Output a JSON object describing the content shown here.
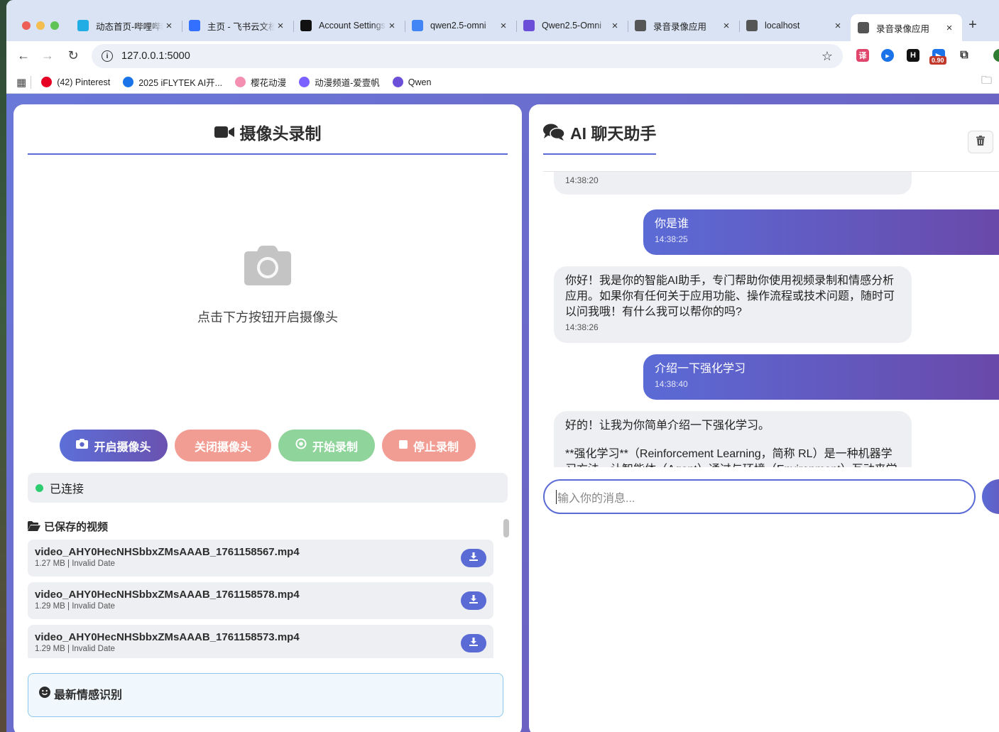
{
  "browser": {
    "tabs": [
      {
        "title": "动态首页-哔哩哔哩",
        "icon": "bilibili-icon",
        "color": "#23ade5"
      },
      {
        "title": "主页 - 飞书云文档",
        "icon": "feishu-icon",
        "color": "#3370ff"
      },
      {
        "title": "Account Settings",
        "icon": "terminal-icon",
        "color": "#111111"
      },
      {
        "title": "qwen2.5-omni",
        "icon": "google-icon",
        "color": "#4285f4"
      },
      {
        "title": "Qwen2.5-Omni",
        "icon": "qwen-icon",
        "color": "#6b4fd8"
      },
      {
        "title": "录音录像应用",
        "icon": "globe-icon",
        "color": "#555555"
      },
      {
        "title": "localhost",
        "icon": "globe-icon",
        "color": "#555555"
      },
      {
        "title": "录音录像应用",
        "icon": "globe-icon",
        "color": "#555555",
        "active": true
      }
    ],
    "url": "127.0.0.1:5000",
    "extension_badge": "0.90",
    "bookmarks": [
      {
        "label": "(42) Pinterest",
        "icon": "pinterest-icon",
        "color": "#e60023"
      },
      {
        "label": "2025 iFLYTEK AI开...",
        "icon": "iflytek-icon",
        "color": "#1a73e8"
      },
      {
        "label": "樱花动漫",
        "icon": "sakura-icon",
        "color": "#f48fb1"
      },
      {
        "label": "动漫频道-爱壹帆",
        "icon": "rocket-icon",
        "color": "#7b61ff"
      },
      {
        "label": "Qwen",
        "icon": "qwen-icon",
        "color": "#6b4fd8"
      }
    ]
  },
  "left": {
    "title": "摄像头录制",
    "camera_hint": "点击下方按钮开启摄像头",
    "buttons": {
      "open": "开启摄像头",
      "close": "关闭摄像头",
      "start": "开始录制",
      "stop": "停止录制"
    },
    "status": "已连接",
    "saved_title": "已保存的视频",
    "videos": [
      {
        "name": "video_AHY0HecNHSbbxZMsAAAB_1761158567.mp4",
        "meta": "1.27 MB | Invalid Date"
      },
      {
        "name": "video_AHY0HecNHSbbxZMsAAAB_1761158578.mp4",
        "meta": "1.29 MB | Invalid Date"
      },
      {
        "name": "video_AHY0HecNHSbbxZMsAAAB_1761158573.mp4",
        "meta": "1.29 MB | Invalid Date"
      }
    ],
    "emotion_title": "最新情感识别"
  },
  "chat": {
    "title": "AI 聊天助手",
    "messages": [
      {
        "role": "ai",
        "text": "",
        "time": "14:38:20"
      },
      {
        "role": "user",
        "text": "你是谁",
        "time": "14:38:25"
      },
      {
        "role": "ai",
        "text": "你好！我是你的智能AI助手，专门帮助你使用视频录制和情感分析应用。如果你有任何关于应用功能、操作流程或技术问题，随时可以问我哦！有什么我可以帮你的吗?",
        "time": "14:38:26"
      },
      {
        "role": "user",
        "text": "介绍一下强化学习",
        "time": "14:38:40"
      },
      {
        "role": "ai",
        "text": "好的！让我为你简单介绍一下强化学习。",
        "text2": "**强化学习**（Reinforcement Learning，简称 RL）是一种机器学习方法，让智能体（Agent）通过与环境（Environment）互动来学",
        "time": ""
      }
    ],
    "input_placeholder": "输入你的消息..."
  }
}
